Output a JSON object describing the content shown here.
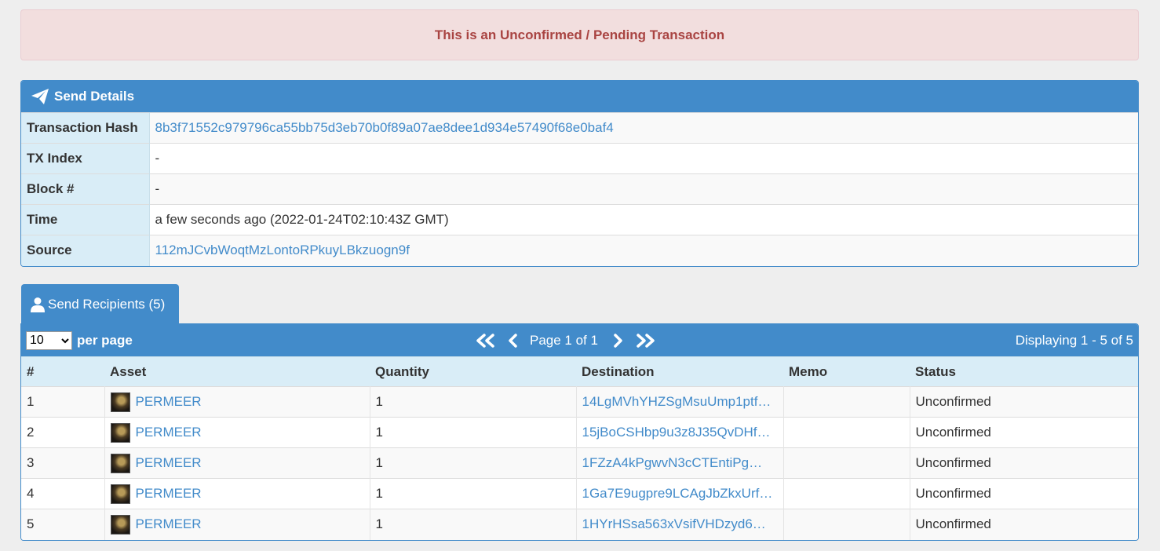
{
  "alert": {
    "text": "This is an Unconfirmed / Pending Transaction"
  },
  "details": {
    "title": "Send Details",
    "rows": [
      {
        "label": "Transaction Hash",
        "value": "8b3f71552c979796ca55bb75d3eb70b0f89a07ae8dee1d934e57490f68e0baf4",
        "link": true
      },
      {
        "label": "TX Index",
        "value": "-",
        "link": false
      },
      {
        "label": "Block #",
        "value": "-",
        "link": false
      },
      {
        "label": "Time",
        "value": "a few seconds ago (2022-01-24T02:10:43Z GMT)",
        "link": false
      },
      {
        "label": "Source",
        "value": "112mJCvbWoqtMzLontoRPkuyLBkzuogn9f",
        "link": true
      }
    ]
  },
  "recipients": {
    "tab_label": "Send Recipients (5)",
    "per_page_value": "10",
    "per_page_label": "per page",
    "page_text": "Page 1 of 1",
    "displaying_text": "Displaying 1 - 5 of 5",
    "columns": [
      "#",
      "Asset",
      "Quantity",
      "Destination",
      "Memo",
      "Status"
    ],
    "rows": [
      {
        "num": "1",
        "asset": "PERMEER",
        "quantity": "1",
        "destination": "14LgMVhYHZSgMsuUmp1ptf…",
        "memo": "",
        "status": "Unconfirmed"
      },
      {
        "num": "2",
        "asset": "PERMEER",
        "quantity": "1",
        "destination": "15jBoCSHbp9u3z8J35QvDHf…",
        "memo": "",
        "status": "Unconfirmed"
      },
      {
        "num": "3",
        "asset": "PERMEER",
        "quantity": "1",
        "destination": "1FZzA4kPgwvN3cCTEntiPg…",
        "memo": "",
        "status": "Unconfirmed"
      },
      {
        "num": "4",
        "asset": "PERMEER",
        "quantity": "1",
        "destination": "1Ga7E9ugpre9LCAgJbZkxUrf…",
        "memo": "",
        "status": "Unconfirmed"
      },
      {
        "num": "5",
        "asset": "PERMEER",
        "quantity": "1",
        "destination": "1HYrHSsa563xVsifVHDzyd6…",
        "memo": "",
        "status": "Unconfirmed"
      }
    ]
  },
  "colors": {
    "primary": "#428bca",
    "alert_bg": "#f2dede",
    "alert_text": "#a94442",
    "label_bg": "#d9edf7"
  },
  "icons": {
    "details": "paper-plane-icon",
    "recipients": "user-icon",
    "first": "double-chevron-left-icon",
    "prev": "chevron-left-icon",
    "next": "chevron-right-icon",
    "last": "double-chevron-right-icon"
  }
}
